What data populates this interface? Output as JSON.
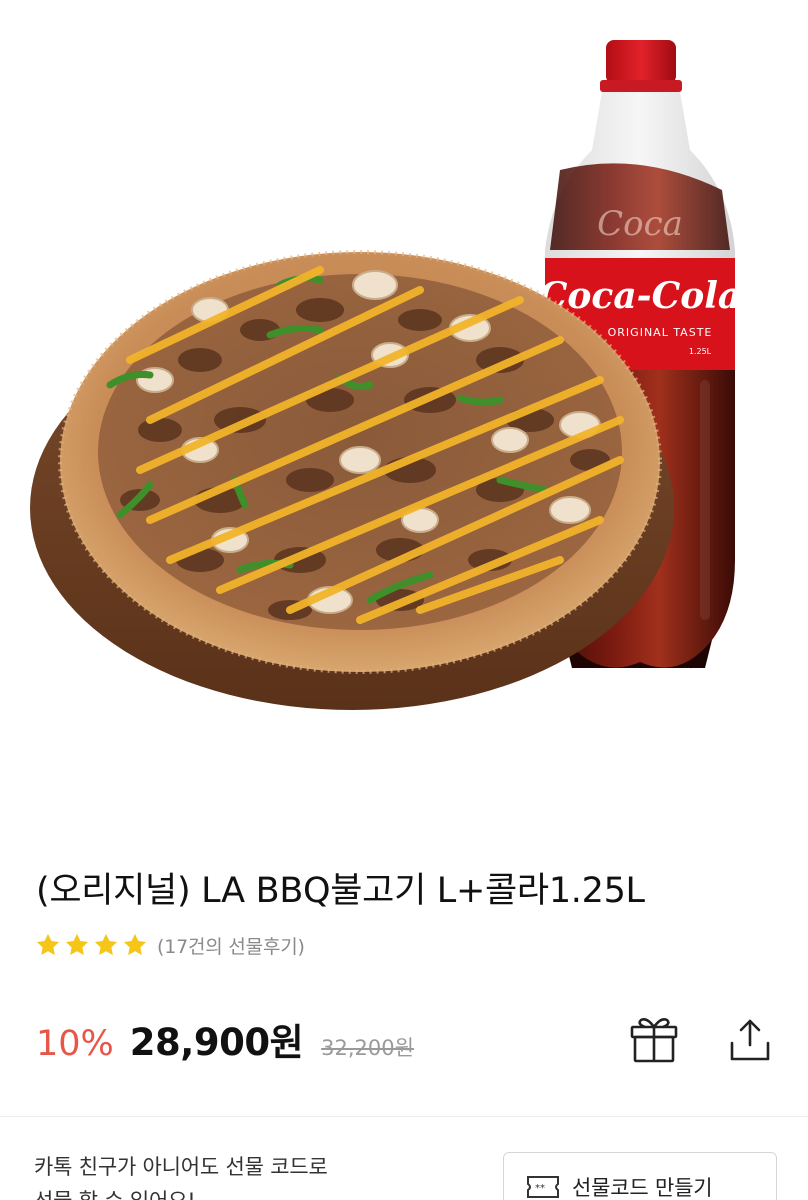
{
  "product": {
    "title": "(오리지널) LA BBQ불고기 L+콜라1.25L",
    "rating_stars": 4,
    "review_count": "(17건의 선물후기)",
    "discount": "10%",
    "price": "28,900원",
    "original_price": "32,200원"
  },
  "hero": {
    "bottle_label": "Coca-Cola",
    "bottle_sublabel": "ORIGINAL TASTE"
  },
  "actions": {
    "gift_icon": "gift-icon",
    "share_icon": "share-icon"
  },
  "gift_code": {
    "note_line1": "카톡 친구가 아니어도 선물 코드로",
    "note_line2": "선물 할 수 있어요!",
    "button_label": "선물코드 만들기",
    "button_icon": "ticket-icon"
  },
  "colors": {
    "star": "#f5c518",
    "discount": "#e8564a",
    "accent_red": "#d8121b"
  }
}
